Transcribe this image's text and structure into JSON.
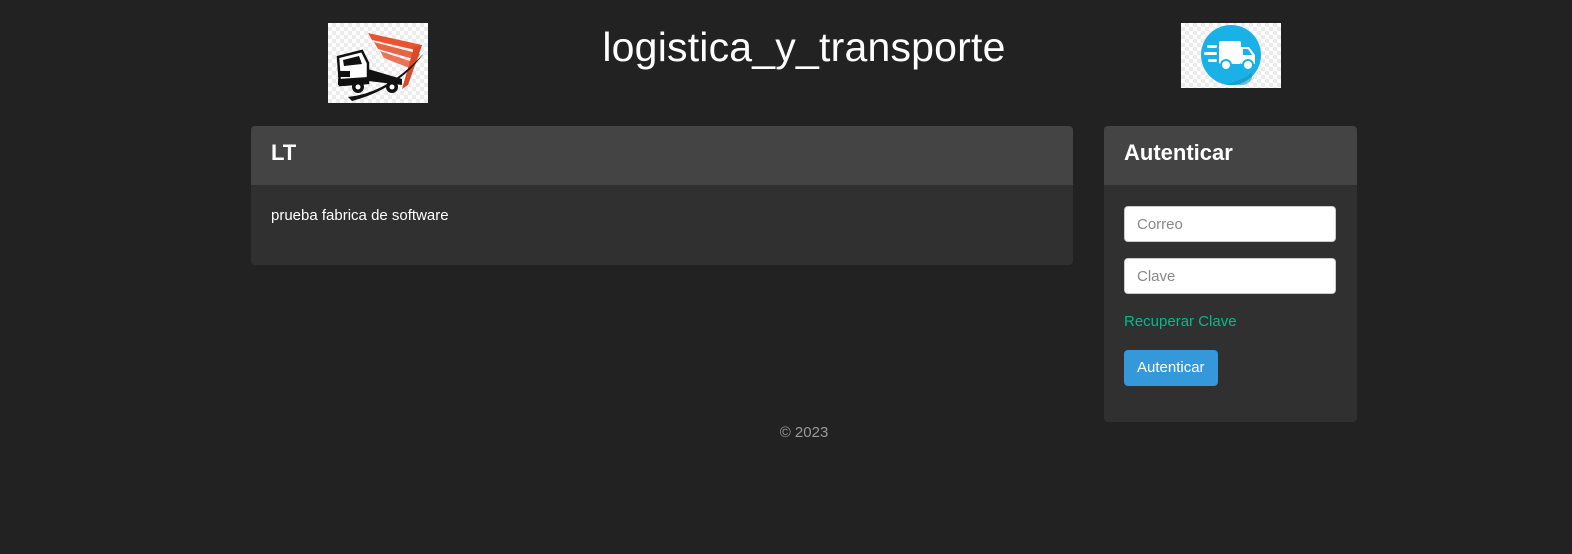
{
  "header": {
    "site_title": "logistica_y_transporte",
    "logo_left_icon": "truck-logo-icon",
    "logo_right_icon": "delivery-van-icon"
  },
  "main_panel": {
    "heading": "LT",
    "body_text": "prueba fabrica de software"
  },
  "auth_panel": {
    "heading": "Autenticar",
    "email_placeholder": "Correo",
    "password_placeholder": "Clave",
    "recover_link": "Recuperar Clave",
    "submit_label": "Autenticar"
  },
  "footer": {
    "text": "© 2023"
  },
  "colors": {
    "background": "#222222",
    "panel": "#303030",
    "panel_heading": "#444444",
    "link": "#00bc8c",
    "primary": "#3498db",
    "muted": "#999999"
  }
}
